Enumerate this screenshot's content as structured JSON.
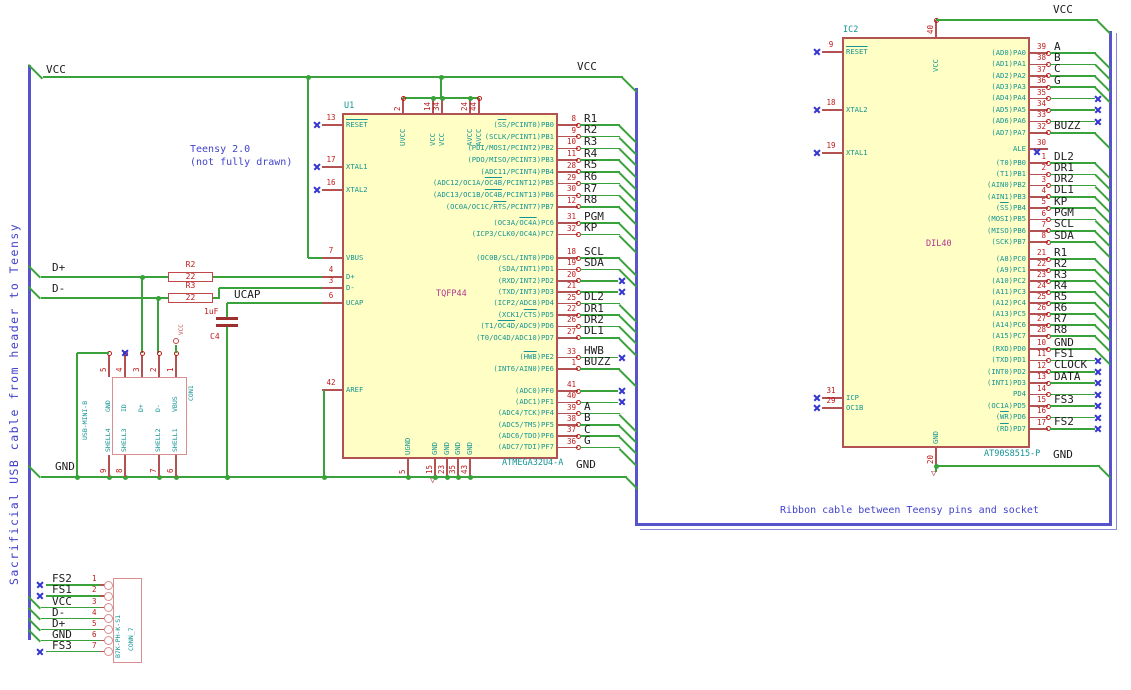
{
  "colors": {
    "wire": "#3aa23a",
    "bus": "#5753cb",
    "nc": "#3535cf",
    "note": "#4343cd",
    "pin": "#b35252",
    "rednum": "#c01818",
    "teal": "#149494",
    "magenta": "#b53592",
    "chipfill": "#ffffc5"
  },
  "notes": {
    "left_vertical": "Sacrificial USB cable from header to Teensy",
    "teensy_line1": "Teensy 2.0",
    "teensy_line2": "(not fully drawn)",
    "ribbon": "Ribbon cable between Teensy pins and socket"
  },
  "power": {
    "vcc": "VCC",
    "gnd": "GND"
  },
  "net_labels": {
    "d_plus": "D+",
    "d_minus": "D-",
    "ucap": "UCAP"
  },
  "u1": {
    "ref": "U1",
    "part": "ATMEGA32U4-A",
    "value": "TQFP44",
    "left_pins": [
      {
        "num": "13",
        "name": "~RESET~",
        "nc": true
      },
      {
        "num": "17",
        "name": "XTAL1",
        "nc": true
      },
      {
        "num": "16",
        "name": "XTAL2",
        "nc": true
      },
      {
        "num": "7",
        "name": "VBUS"
      },
      {
        "num": "4",
        "name": "D+"
      },
      {
        "num": "3",
        "name": "D-"
      },
      {
        "num": "6",
        "name": "UCAP"
      },
      {
        "num": "42",
        "name": "AREF"
      }
    ],
    "top_pins": [
      {
        "num": "2",
        "name": "UVCC"
      },
      {
        "num": "14",
        "name": "VCC"
      },
      {
        "num": "34",
        "name": "VCC"
      },
      {
        "num": "24",
        "name": "AVCC"
      },
      {
        "num": "44",
        "name": "AVCC"
      }
    ],
    "bottom_pins": [
      {
        "num": "5",
        "name": "UGND"
      },
      {
        "num": "15",
        "name": "GND"
      },
      {
        "num": "23",
        "name": "GND"
      },
      {
        "num": "35",
        "name": "GND"
      },
      {
        "num": "43",
        "name": "GND"
      }
    ],
    "right_groups": [
      [
        {
          "num": "8",
          "name": "(~SS~/PCINT0)PB0",
          "net": "R1"
        },
        {
          "num": "9",
          "name": "(SCLK/PCINT1)PB1",
          "net": "R2"
        },
        {
          "num": "10",
          "name": "(PDI/MOSI/PCINT2)PB2",
          "net": "R3"
        },
        {
          "num": "11",
          "name": "(PDO/MISO/PCINT3)PB3",
          "net": "R4"
        },
        {
          "num": "28",
          "name": "(ADC11/PCINT4)PB4",
          "net": "R5"
        },
        {
          "num": "29",
          "name": "(ADC12/OC1A/~OC4B~/PCINT12)PB5",
          "net": "R6"
        },
        {
          "num": "30",
          "name": "(ADC13/OC1B/~OC4B~/PCINT13)PB6",
          "net": "R7"
        },
        {
          "num": "12",
          "name": "(OC0A/OC1C/~RTS~/PCINT7)PB7",
          "net": "R8"
        }
      ],
      [
        {
          "num": "31",
          "name": "(OC3A/~OC4A~)PC6",
          "net": "PGM"
        },
        {
          "num": "32",
          "name": "(ICP3/CLK0/OC4A)PC7",
          "net": "KP"
        }
      ],
      [
        {
          "num": "18",
          "name": "(OC0B/SCL/INT0)PD0",
          "net": "SCL"
        },
        {
          "num": "19",
          "name": "(SDA/INT1)PD1",
          "net": "SDA"
        },
        {
          "num": "20",
          "name": "(RXD/INT2)PD2",
          "nc": "end"
        },
        {
          "num": "21",
          "name": "(TXD/INT3)PD3",
          "nc": "end"
        },
        {
          "num": "25",
          "name": "(ICP2/ADC8)PD4",
          "net": "DL2"
        },
        {
          "num": "22",
          "name": "(XCK1/~CTS~)PD5",
          "net": "DR1"
        },
        {
          "num": "26",
          "name": "(T1/~OC4D~/ADC9)PD6",
          "net": "DR2"
        },
        {
          "num": "27",
          "name": "(T0/OC4D/ADC10)PD7",
          "net": "DL1"
        }
      ],
      [
        {
          "num": "33",
          "name": "(~HWB~)PE2",
          "net": "HWB",
          "nc": "end"
        },
        {
          "num": "1",
          "name": "(INT6/AIN0)PE6",
          "net": "BUZZ"
        }
      ],
      [
        {
          "num": "41",
          "name": "(ADC0)PF0",
          "nc": "end"
        },
        {
          "num": "40",
          "name": "(ADC1)PF1",
          "nc": "end"
        },
        {
          "num": "39",
          "name": "(ADC4/TCK)PF4",
          "net": "A"
        },
        {
          "num": "38",
          "name": "(ADC5/TMS)PF5",
          "net": "B"
        },
        {
          "num": "37",
          "name": "(ADC6/TDO)PF6",
          "net": "C"
        },
        {
          "num": "36",
          "name": "(ADC7/TDI)PF7",
          "net": "G"
        }
      ]
    ]
  },
  "ic2": {
    "ref": "IC2",
    "part": "AT90S8515-P",
    "value": "DIL40",
    "left_pins": [
      {
        "num": "9",
        "name": "~RESET~",
        "nc": true
      },
      {
        "num": "18",
        "name": "XTAL2",
        "nc": true
      },
      {
        "num": "19",
        "name": "XTAL1",
        "nc": true
      },
      {
        "num": "31",
        "name": "ICP",
        "nc": true
      },
      {
        "num": "29",
        "name": "OC1B",
        "nc": true
      }
    ],
    "top_pins": [
      {
        "num": "40",
        "name": "VCC"
      }
    ],
    "bottom_pins": [
      {
        "num": "20",
        "name": "GND"
      }
    ],
    "right_groups": [
      [
        {
          "num": "39",
          "name": "(AD0)PA0",
          "net": "A"
        },
        {
          "num": "38",
          "name": "(AD1)PA1",
          "net": "B"
        },
        {
          "num": "37",
          "name": "(AD2)PA2",
          "net": "C"
        },
        {
          "num": "36",
          "name": "(AD3)PA3",
          "net": "G"
        },
        {
          "num": "35",
          "name": "(AD4)PA4",
          "nc": "end"
        },
        {
          "num": "34",
          "name": "(AD5)PA5",
          "nc": "end"
        },
        {
          "num": "33",
          "name": "(AD6)PA6",
          "nc": "end"
        },
        {
          "num": "32",
          "name": "(AD7)PA7",
          "net": "BUZZ"
        }
      ],
      [
        {
          "num": "30",
          "name": "ALE",
          "nc": "pin"
        }
      ],
      [
        {
          "num": "1",
          "name": "(T0)PB0",
          "net": "DL2"
        },
        {
          "num": "2",
          "name": "(T1)PB1",
          "net": "DR1"
        },
        {
          "num": "3",
          "name": "(AIN0)PB2",
          "net": "DR2"
        },
        {
          "num": "4",
          "name": "(AIN1)PB3",
          "net": "DL1"
        },
        {
          "num": "5",
          "name": "(~SS~)PB4",
          "net": "KP"
        },
        {
          "num": "6",
          "name": "(MOSI)PB5",
          "net": "PGM"
        },
        {
          "num": "7",
          "name": "(MISO)PB6",
          "net": "SCL"
        },
        {
          "num": "8",
          "name": "(SCK)PB7",
          "net": "SDA"
        }
      ],
      [
        {
          "num": "21",
          "name": "(A8)PC0",
          "net": "R1"
        },
        {
          "num": "22",
          "name": "(A9)PC1",
          "net": "R2"
        },
        {
          "num": "23",
          "name": "(A10)PC2",
          "net": "R3"
        },
        {
          "num": "24",
          "name": "(A11)PC3",
          "net": "R4"
        },
        {
          "num": "25",
          "name": "(A12)PC4",
          "net": "R5"
        },
        {
          "num": "26",
          "name": "(A13)PC5",
          "net": "R6"
        },
        {
          "num": "27",
          "name": "(A14)PC6",
          "net": "R7"
        },
        {
          "num": "28",
          "name": "(A15)PC7",
          "net": "R8"
        }
      ],
      [
        {
          "num": "10",
          "name": "(RXD)PD0",
          "net": "GND"
        },
        {
          "num": "11",
          "name": "(TXD)PD1",
          "net": "FS1",
          "nc": "end"
        },
        {
          "num": "12",
          "name": "(INT0)PD2",
          "net": "CLOCK",
          "nc": "end"
        },
        {
          "num": "13",
          "name": "(INT1)PD3",
          "net": "DATA",
          "nc": "end"
        },
        {
          "num": "14",
          "name": "PD4",
          "nc": "end"
        },
        {
          "num": "15",
          "name": "(OC1A)PD5",
          "net": "FS3",
          "nc": "end"
        },
        {
          "num": "16",
          "name": "(~WR~)PD6",
          "nc": "end"
        },
        {
          "num": "17",
          "name": "(~RD~)PD7",
          "net": "FS2",
          "nc": "end"
        }
      ]
    ]
  },
  "con1": {
    "ref": "CON1",
    "part": "USB-MINI-B",
    "top_pins": [
      {
        "num": "5",
        "name": "GND"
      },
      {
        "num": "4",
        "name": "ID",
        "nc": true
      },
      {
        "num": "3",
        "name": "D+"
      },
      {
        "num": "2",
        "name": "D-"
      },
      {
        "num": "1",
        "name": "VBUS"
      }
    ],
    "bottom_pins": [
      {
        "num": "9",
        "name": "SHELL4"
      },
      {
        "num": "8",
        "name": "SHELL3"
      },
      {
        "num": "7",
        "name": "SHELL2"
      },
      {
        "num": "6",
        "name": "SHELL1"
      }
    ]
  },
  "conn7": {
    "ref": "CONN_7",
    "part": "B7K-PH-K-S1",
    "pins": [
      {
        "num": "1",
        "net": "FS2",
        "nc": true
      },
      {
        "num": "2",
        "net": "FS1",
        "nc": true
      },
      {
        "num": "3",
        "net": "VCC"
      },
      {
        "num": "4",
        "net": "D-"
      },
      {
        "num": "5",
        "net": "D+"
      },
      {
        "num": "6",
        "net": "GND"
      },
      {
        "num": "7",
        "net": "FS3",
        "nc": true
      }
    ]
  },
  "r2": {
    "ref": "R2",
    "value": "22"
  },
  "r3": {
    "ref": "R3",
    "value": "22"
  },
  "c4": {
    "ref": "C4",
    "value": "1uF"
  },
  "vcc_symbol": "VCC"
}
